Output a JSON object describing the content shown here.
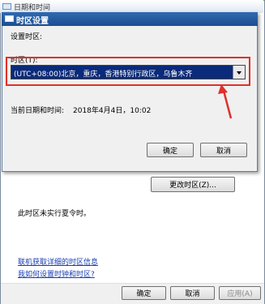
{
  "outer_window": {
    "title": "日期和时间",
    "change_tz_button": "更改时区(Z)...",
    "dst_text": "此时区未实行夏令时。",
    "link_info": "联机获取详细的时区信息",
    "link_howto": "我如何设置时钟和时区?",
    "ok": "确定",
    "cancel": "取消",
    "apply": "应用(A)"
  },
  "dialog": {
    "title": "时区设置",
    "set_tz_label": "设置时区:",
    "tz_label": "时区(T):",
    "tz_value": "(UTC+08:00)北京，重庆，香港特别行政区，乌鲁木齐",
    "current_label": "当前日期和时间:",
    "current_value": "2018年4月4日，10:02",
    "ok": "确定",
    "cancel": "取消"
  },
  "colors": {
    "highlight": "#e0302a",
    "title_bar": "#2f6bb0",
    "selected_bg": "#0a2a7a"
  }
}
